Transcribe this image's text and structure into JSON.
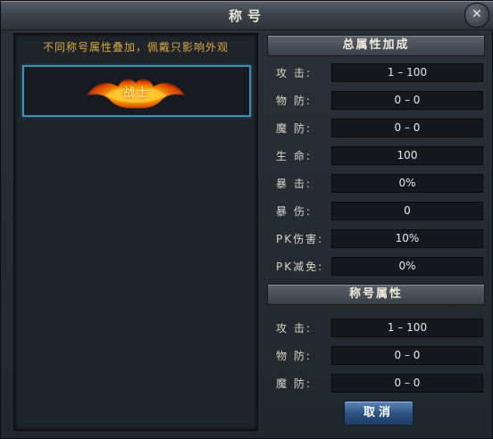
{
  "window": {
    "title": "称号",
    "close_symbol": "✕"
  },
  "left": {
    "hint": "不同称号属性叠加，佩戴只影响外观",
    "selected_title": {
      "text": "战士",
      "icon": "flaming-title-emblem"
    }
  },
  "total": {
    "header": "总属性加成",
    "rows": [
      {
        "label": "攻  击:",
        "value": "1 – 100"
      },
      {
        "label": "物  防:",
        "value": "0 – 0"
      },
      {
        "label": "魔  防:",
        "value": "0 – 0"
      },
      {
        "label": "生  命:",
        "value": "100"
      },
      {
        "label": "暴  击:",
        "value": "0%"
      },
      {
        "label": "暴  伤:",
        "value": "0"
      },
      {
        "label": "PK伤害:",
        "value": "10%"
      },
      {
        "label": "PK减免:",
        "value": "0%"
      }
    ]
  },
  "title_attrs": {
    "header": "称号属性",
    "rows": [
      {
        "label": "攻  击:",
        "value": "1 – 100"
      },
      {
        "label": "物  防:",
        "value": "0 – 0"
      },
      {
        "label": "魔  防:",
        "value": "0 – 0"
      }
    ]
  },
  "buttons": {
    "cancel": "取消"
  },
  "colors": {
    "accent_blue": "#3f8fb0",
    "hint_gold": "#d9a941",
    "button_blue": "#2b5180"
  }
}
